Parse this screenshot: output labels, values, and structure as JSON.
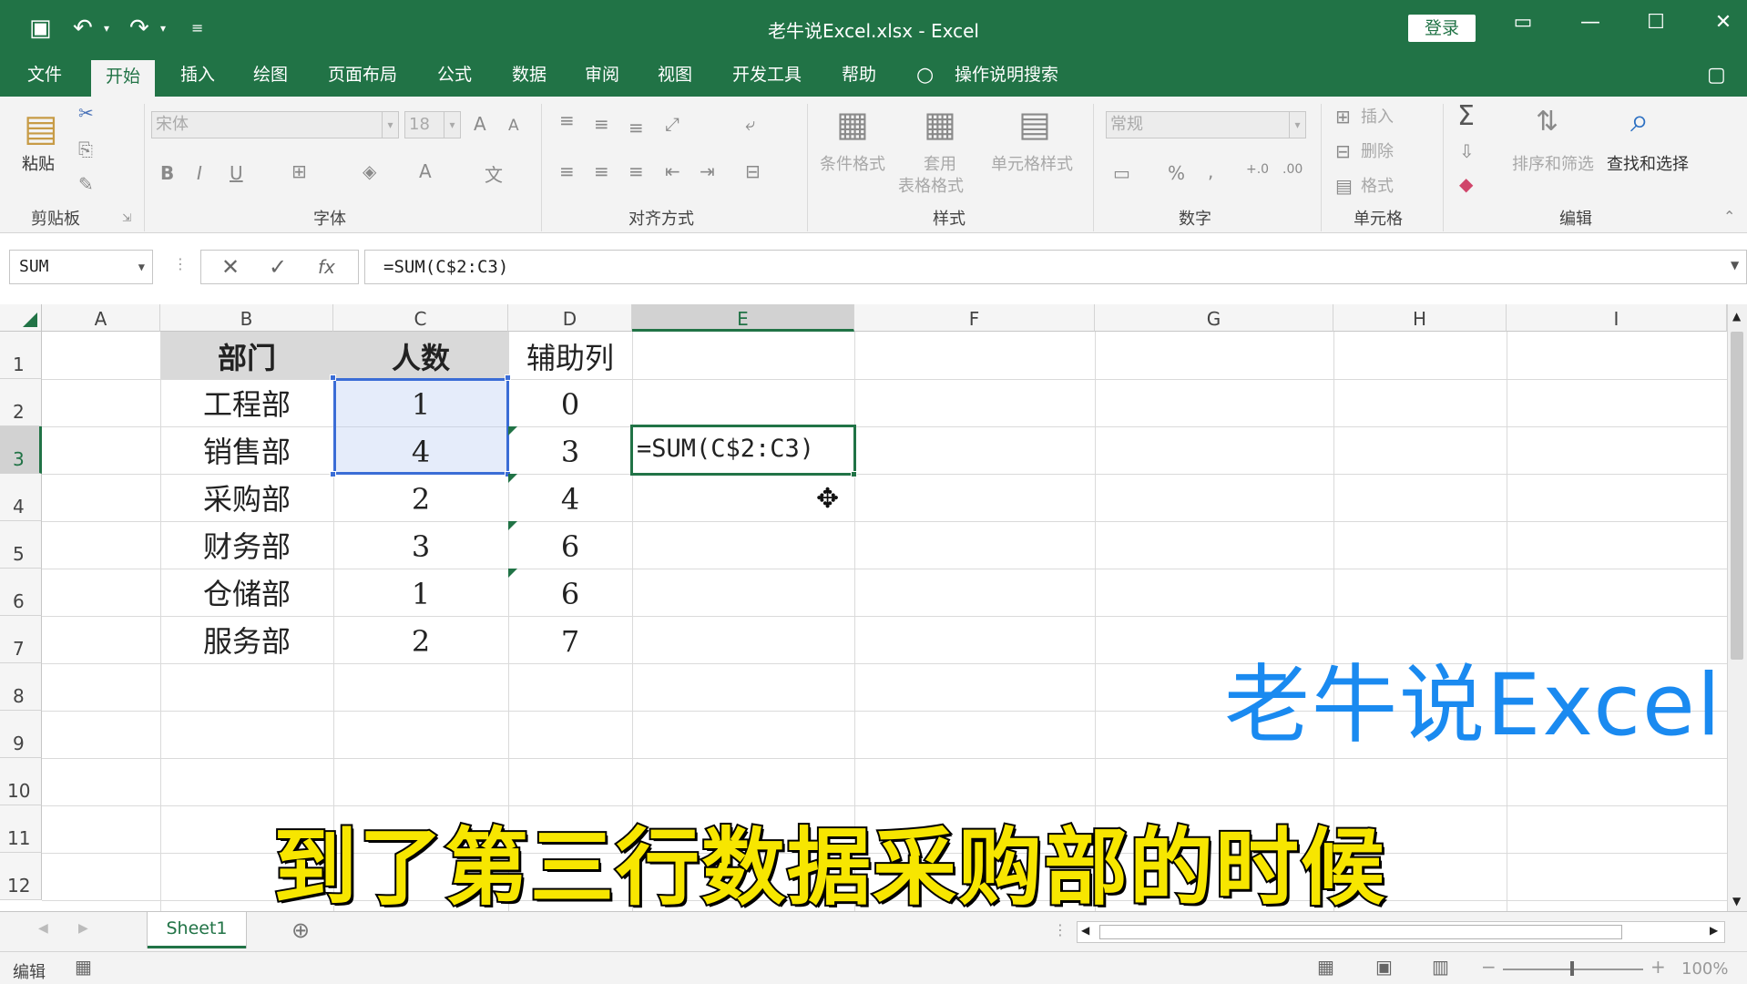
{
  "window": {
    "title": "老牛说Excel.xlsx  -  Excel",
    "login_label": "登录",
    "quick_access": [
      "save-icon",
      "undo-icon",
      "redo-icon",
      "customize-icon"
    ]
  },
  "ribbon": {
    "tabs": [
      "文件",
      "开始",
      "插入",
      "绘图",
      "页面布局",
      "公式",
      "数据",
      "审阅",
      "视图",
      "开发工具",
      "帮助"
    ],
    "active_tab": "开始",
    "tell_me": "操作说明搜索",
    "clipboard": {
      "paste": "粘贴",
      "group": "剪贴板"
    },
    "font": {
      "name": "宋体",
      "size": "18",
      "group": "字体"
    },
    "alignment": {
      "group": "对齐方式"
    },
    "styles": {
      "conditional": "条件格式",
      "table_1": "套用",
      "table_2": "表格格式",
      "cell_styles": "单元格样式",
      "group": "样式"
    },
    "number": {
      "format": "常规",
      "group": "数字"
    },
    "cells": {
      "insert": "插入",
      "delete": "删除",
      "format": "格式",
      "group": "单元格"
    },
    "editing": {
      "sort": "排序和筛选",
      "find": "查找和选择",
      "group": "编辑"
    }
  },
  "formula_bar": {
    "name_box": "SUM",
    "formula": "=SUM(C$2:C3)",
    "fx": "fx"
  },
  "sheet": {
    "columns": [
      "A",
      "B",
      "C",
      "D",
      "E",
      "F",
      "G",
      "H",
      "I"
    ],
    "selected_column": "E",
    "rows": [
      "1",
      "2",
      "3",
      "4",
      "5",
      "6",
      "7",
      "8",
      "9",
      "10",
      "11",
      "12"
    ],
    "selected_row": "3",
    "headers": {
      "b": "部门",
      "c": "人数",
      "d": "辅助列"
    },
    "data": [
      {
        "dept": "工程部",
        "count": "1",
        "helper": "0"
      },
      {
        "dept": "销售部",
        "count": "4",
        "helper": "3"
      },
      {
        "dept": "采购部",
        "count": "2",
        "helper": "4"
      },
      {
        "dept": "财务部",
        "count": "3",
        "helper": "6"
      },
      {
        "dept": "仓储部",
        "count": "1",
        "helper": "6"
      },
      {
        "dept": "服务部",
        "count": "2",
        "helper": "7"
      }
    ],
    "editing_cell": "=SUM(C$2:C3)",
    "watermark": "老牛说Excel",
    "caption": "到了第三行数据采购部的时候"
  },
  "sheet_tabs": {
    "active": "Sheet1"
  },
  "status": {
    "mode": "编辑",
    "zoom": "100%"
  },
  "colors": {
    "accent": "#217346",
    "selection": "#3b6dd6",
    "watermark": "#1a8af0",
    "caption": "#f7e600"
  }
}
